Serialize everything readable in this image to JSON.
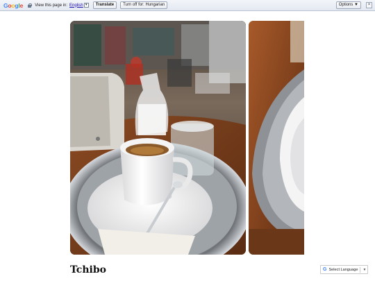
{
  "translate_bar": {
    "logo_letters": [
      "G",
      "o",
      "o",
      "g",
      "l",
      "e"
    ],
    "prompt": "View this page in:",
    "language": "English",
    "select_arrow": "▾",
    "translate_label": "Translate",
    "turn_off_label": "Turn off for: Hungarian",
    "options_label": "Options ▼",
    "close_label": "×"
  },
  "page": {
    "title": "Tchibo"
  },
  "language_widget": {
    "icon": "G",
    "label": "Select Language",
    "arrow": "▼"
  },
  "icons": {
    "lock": "lock-icon",
    "google": "google-g-icon"
  }
}
